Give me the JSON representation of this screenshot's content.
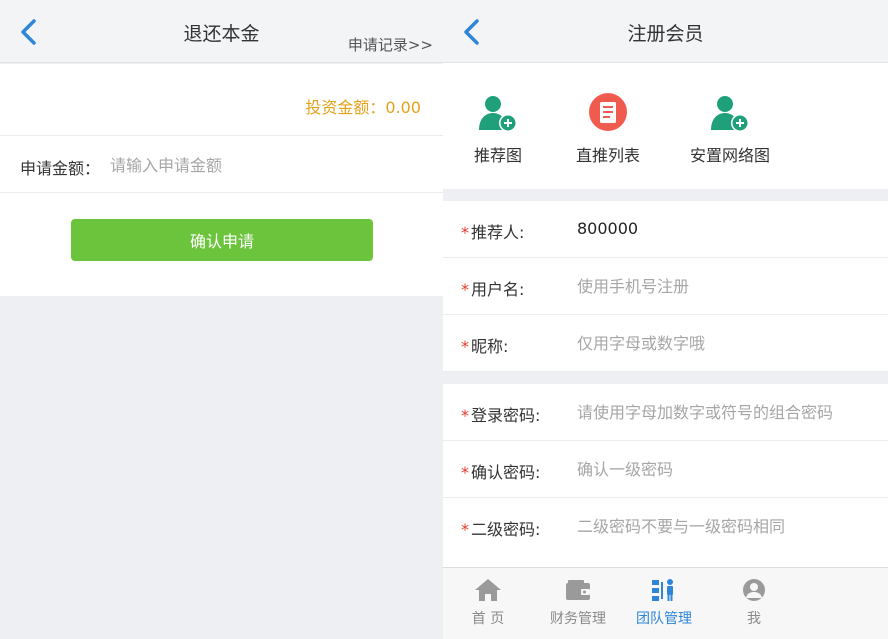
{
  "left": {
    "header": {
      "title": "退还本金",
      "link": "申请记录>>"
    },
    "investment_amount": "投资金额：0.00",
    "apply": {
      "label": "申请金额：",
      "placeholder": "请输入申请金额"
    },
    "confirm_label": "确认申请"
  },
  "right": {
    "header": {
      "title": "注册会员"
    },
    "actions": [
      {
        "label": "推荐图",
        "icon": "add-user-icon",
        "color": "#1fa07a"
      },
      {
        "label": "直推列表",
        "icon": "list-icon",
        "color": "#ef5b4e"
      },
      {
        "label": "安置网络图",
        "icon": "add-user-icon",
        "color": "#1fa07a"
      }
    ],
    "form": {
      "required_mark": "*",
      "referrer": {
        "label": "推荐人:",
        "value": "800000"
      },
      "username": {
        "label": "用户名:",
        "placeholder": "使用手机号注册"
      },
      "nickname": {
        "label": "昵称:",
        "placeholder": "仅用字母或数字哦"
      },
      "login_password": {
        "label": "登录密码:",
        "placeholder": "请使用字母加数字或符号的组合密码"
      },
      "confirm_password": {
        "label": "确认密码:",
        "placeholder": "确认一级密码"
      },
      "secondary_password": {
        "label": "二级密码:",
        "placeholder": "二级密码不要与一级密码相同"
      }
    },
    "tabs": [
      {
        "label": "首 页",
        "icon": "home-icon"
      },
      {
        "label": "财务管理",
        "icon": "wallet-icon"
      },
      {
        "label": "团队管理",
        "icon": "team-icon",
        "active": true
      },
      {
        "label": "我",
        "icon": "user-icon"
      }
    ]
  },
  "colors": {
    "accent_blue": "#2e86d9",
    "confirm_green": "#6cc43d",
    "amount_orange": "#e4a21b",
    "required_red": "#e63a2b",
    "icon_green": "#1fa07a",
    "icon_red": "#ef5b4e"
  }
}
